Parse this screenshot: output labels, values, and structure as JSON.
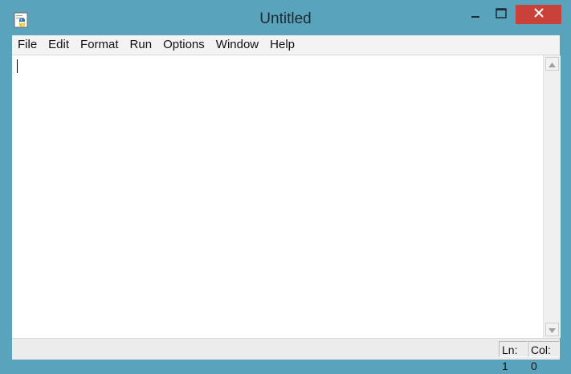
{
  "window": {
    "title": "Untitled",
    "app_icon": "python-idle-icon",
    "controls": [
      "minimize-icon",
      "maximize-icon",
      "close-icon"
    ]
  },
  "menu": {
    "items": [
      "File",
      "Edit",
      "Format",
      "Run",
      "Options",
      "Window",
      "Help"
    ]
  },
  "editor": {
    "content": ""
  },
  "status": {
    "line": "Ln: 1",
    "column": "Col: 0"
  },
  "colors": {
    "titlebar": "#5aa3bd",
    "close_button": "#c9423a",
    "editor_bg": "#ffffff"
  }
}
